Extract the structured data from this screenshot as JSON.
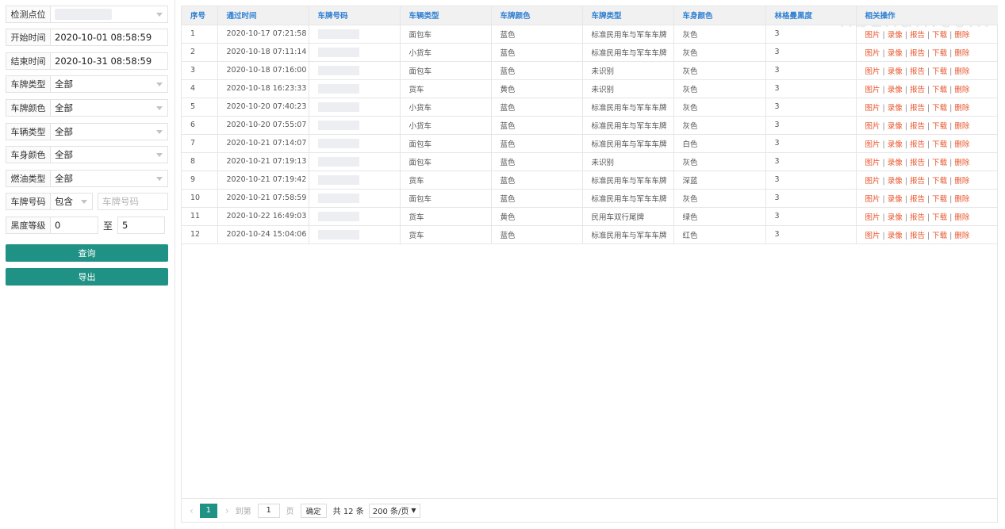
{
  "filters": {
    "site": {
      "label": "检测点位"
    },
    "start_time": {
      "label": "开始时间",
      "value": "2020-10-01 08:58:59"
    },
    "end_time": {
      "label": "结束时间",
      "value": "2020-10-31 08:58:59"
    },
    "plate_type": {
      "label": "车牌类型",
      "value": "全部"
    },
    "plate_color": {
      "label": "车牌颜色",
      "value": "全部"
    },
    "vehicle_type": {
      "label": "车辆类型",
      "value": "全部"
    },
    "body_color": {
      "label": "车身颜色",
      "value": "全部"
    },
    "fuel_type": {
      "label": "燃油类型",
      "value": "全部"
    },
    "plate_number": {
      "label": "车牌号码",
      "mode": "包含",
      "placeholder": "车牌号码"
    },
    "blackness": {
      "label": "黑度等级",
      "min": "0",
      "to": "至",
      "max": "5"
    },
    "query_button": "查询",
    "export_button": "导出"
  },
  "table": {
    "headers": [
      "序号",
      "通过时间",
      "车牌号码",
      "车辆类型",
      "车牌颜色",
      "车牌类型",
      "车身颜色",
      "林格曼黑度",
      "相关操作"
    ],
    "rows": [
      {
        "no": "1",
        "time": "2020-10-17 07:21:58",
        "vtype": "面包车",
        "pcolor": "蓝色",
        "ptype": "标准民用车与军车车牌",
        "bcolor": "灰色",
        "black": "3"
      },
      {
        "no": "2",
        "time": "2020-10-18 07:11:14",
        "vtype": "小货车",
        "pcolor": "蓝色",
        "ptype": "标准民用车与军车车牌",
        "bcolor": "灰色",
        "black": "3"
      },
      {
        "no": "3",
        "time": "2020-10-18 07:16:00",
        "vtype": "面包车",
        "pcolor": "蓝色",
        "ptype": "未识别",
        "bcolor": "灰色",
        "black": "3"
      },
      {
        "no": "4",
        "time": "2020-10-18 16:23:33",
        "vtype": "货车",
        "pcolor": "黄色",
        "ptype": "未识别",
        "bcolor": "灰色",
        "black": "3"
      },
      {
        "no": "5",
        "time": "2020-10-20 07:40:23",
        "vtype": "小货车",
        "pcolor": "蓝色",
        "ptype": "标准民用车与军车车牌",
        "bcolor": "灰色",
        "black": "3"
      },
      {
        "no": "6",
        "time": "2020-10-20 07:55:07",
        "vtype": "小货车",
        "pcolor": "蓝色",
        "ptype": "标准民用车与军车车牌",
        "bcolor": "灰色",
        "black": "3"
      },
      {
        "no": "7",
        "time": "2020-10-21 07:14:07",
        "vtype": "面包车",
        "pcolor": "蓝色",
        "ptype": "标准民用车与军车车牌",
        "bcolor": "白色",
        "black": "3"
      },
      {
        "no": "8",
        "time": "2020-10-21 07:19:13",
        "vtype": "面包车",
        "pcolor": "蓝色",
        "ptype": "未识别",
        "bcolor": "灰色",
        "black": "3"
      },
      {
        "no": "9",
        "time": "2020-10-21 07:19:42",
        "vtype": "货车",
        "pcolor": "蓝色",
        "ptype": "标准民用车与军车车牌",
        "bcolor": "深蓝",
        "black": "3"
      },
      {
        "no": "10",
        "time": "2020-10-21 07:58:59",
        "vtype": "面包车",
        "pcolor": "蓝色",
        "ptype": "标准民用车与军车车牌",
        "bcolor": "灰色",
        "black": "3"
      },
      {
        "no": "11",
        "time": "2020-10-22 16:49:03",
        "vtype": "货车",
        "pcolor": "黄色",
        "ptype": "民用车双行尾牌",
        "bcolor": "绿色",
        "black": "3"
      },
      {
        "no": "12",
        "time": "2020-10-24 15:04:06",
        "vtype": "货车",
        "pcolor": "蓝色",
        "ptype": "标准民用车与军车车牌",
        "bcolor": "红色",
        "black": "3"
      }
    ],
    "actions": [
      "图片",
      "录像",
      "报告",
      "下载",
      "删除"
    ]
  },
  "pagination": {
    "prev": "‹",
    "current_page": "1",
    "next": "›",
    "goto_label": "到第",
    "goto_value": "1",
    "page_unit": "页",
    "confirm": "确定",
    "total": "共 12 条",
    "page_size": "200 条/页"
  },
  "watermark": "hbzhan.com",
  "colors": {
    "accent": "#1f9285",
    "header_text": "#2e7fd2",
    "action_link": "#e8542a"
  }
}
